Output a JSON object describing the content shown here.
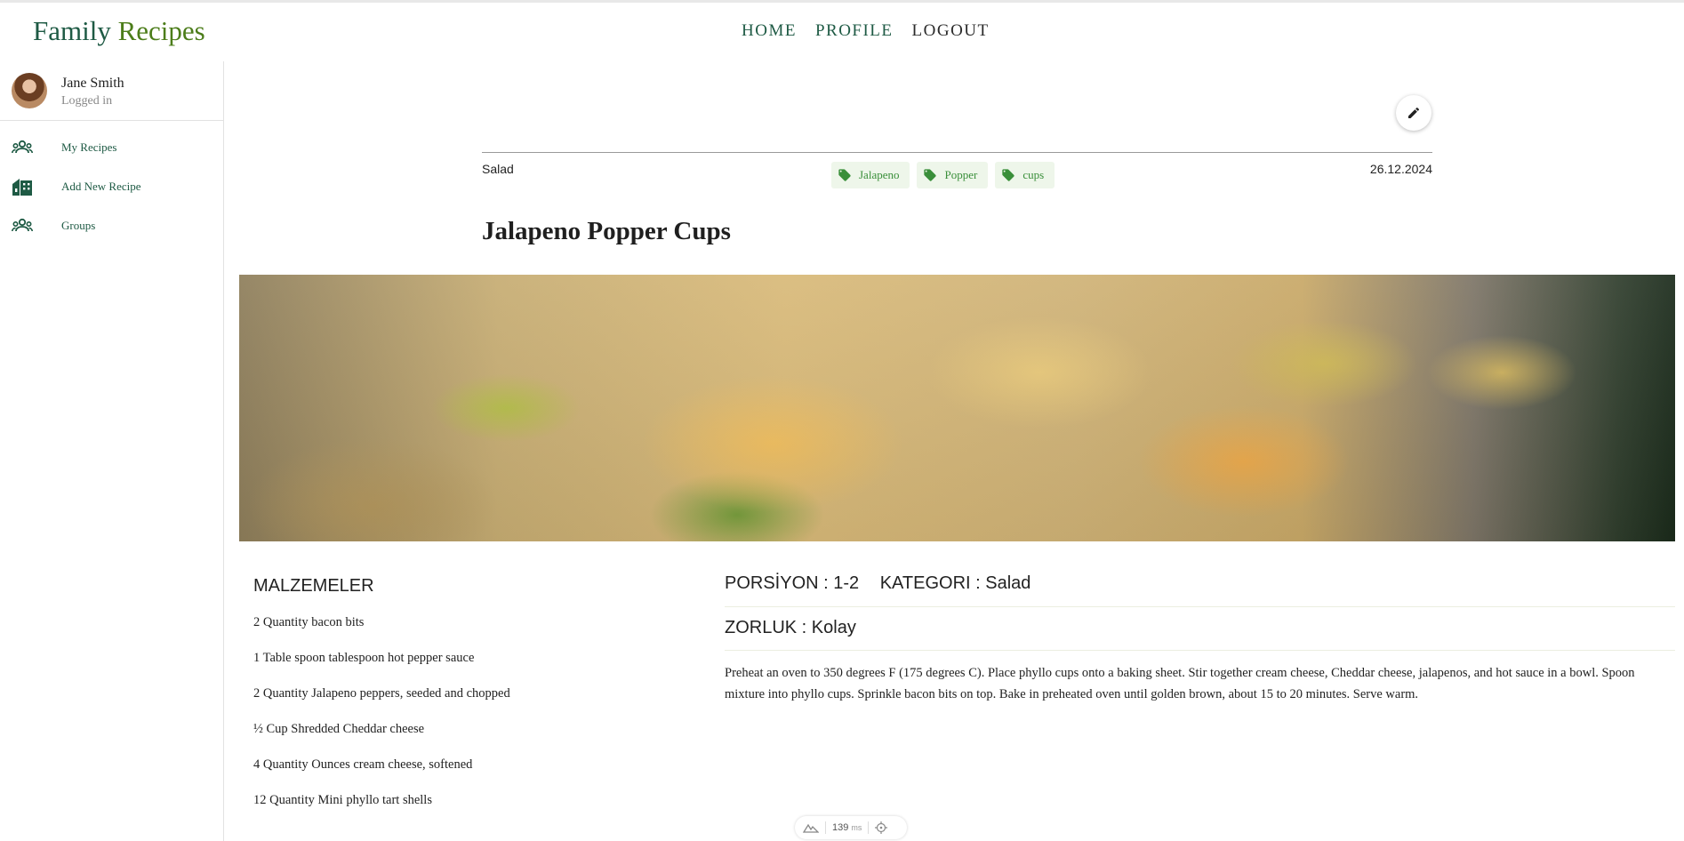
{
  "brand": {
    "word1": "Family",
    "word2": "Recipes"
  },
  "nav": [
    {
      "label": "HOME"
    },
    {
      "label": "PROFILE"
    },
    {
      "label": "LOGOUT"
    }
  ],
  "user": {
    "name": "Jane Smith",
    "status": "Logged in"
  },
  "sidebar": {
    "items": [
      {
        "label": "My Recipes",
        "icon": "group-icon"
      },
      {
        "label": "Add New Recipe",
        "icon": "buildings-icon"
      },
      {
        "label": "Groups",
        "icon": "group-icon"
      }
    ]
  },
  "recipe": {
    "category": "Salad",
    "date": "26.12.2024",
    "tags": [
      "Jalapeno",
      "Popper",
      "cups"
    ],
    "title": "Jalapeno Popper Cups",
    "ingredients_title": "MALZEMELER",
    "ingredients": [
      "2 Quantity bacon bits",
      "1 Table spoon tablespoon hot pepper sauce",
      "2 Quantity Jalapeno peppers, seeded and chopped",
      "½ Cup Shredded Cheddar cheese",
      "4 Quantity Ounces cream cheese, softened",
      "12 Quantity Mini phyllo tart shells"
    ],
    "servings_label": "PORSİYON : 1-2",
    "category_label": "KATEGORI : Salad",
    "difficulty_label": "ZORLUK : Kolay",
    "description": "Preheat an oven to 350 degrees F (175 degrees C). Place phyllo cups onto a baking sheet. Stir together cream cheese, Cheddar cheese, jalapenos, and hot sauce in a bowl. Spoon mixture into phyllo cups. Sprinkle bacon bits on top. Bake in preheated oven until golden brown, about 15 to 20 minutes. Serve warm."
  },
  "perf": {
    "value": "139",
    "unit": "ms"
  },
  "colors": {
    "brand_green": "#1e5a44",
    "brand_light_green": "#4c7d1a",
    "tag_bg": "#eef6ea",
    "tag_text": "#3a8f3a"
  }
}
